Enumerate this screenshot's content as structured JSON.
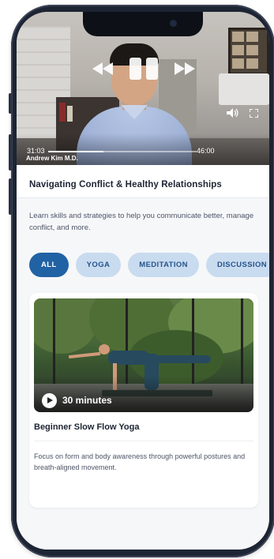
{
  "video": {
    "current_time": "31:03",
    "duration": "46:00",
    "progress": 0.37,
    "presenter": "Andrew Kim M.D."
  },
  "program": {
    "title": "Navigating Conflict & Healthy Relationships",
    "description": "Learn skills and strategies to help you communicate better, manage conflict, and more."
  },
  "filters": {
    "active": "ALL",
    "items": [
      "ALL",
      "YOGA",
      "MEDITATION",
      "DISCUSSION"
    ]
  },
  "card": {
    "duration": "30 minutes",
    "title": "Beginner Slow Flow Yoga",
    "description": "Focus on form and body awareness through powerful postures and breath-aligned movement."
  },
  "icons": {
    "rewind": "rewind-icon",
    "pause": "pause-icon",
    "fast_forward": "fast-forward-icon",
    "volume": "volume-icon",
    "fullscreen": "fullscreen-icon",
    "play": "play-icon"
  },
  "colors": {
    "accent": "#2162a5",
    "chip_bg": "#c9dbef",
    "chip_text": "#24548d",
    "phone_frame": "#1d2433"
  }
}
